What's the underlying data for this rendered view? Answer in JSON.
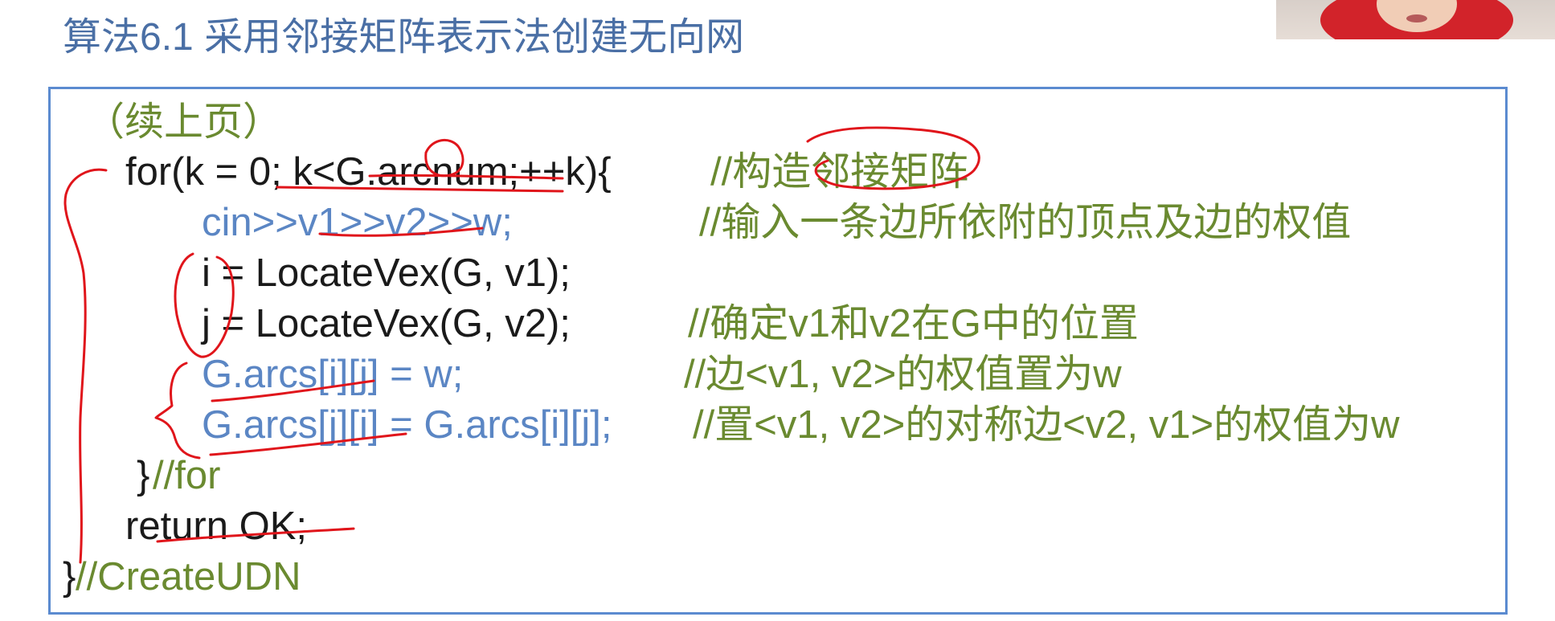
{
  "slide": {
    "title": "算法6.1 采用邻接矩阵表示法创建无向网"
  },
  "code": {
    "continued": "（续上页）",
    "lines": [
      {
        "code": "for(k = 0; k<G.arcnum;++k){",
        "comment": "//构造邻接矩阵"
      },
      {
        "code": "cin>>v1>>v2>>w;",
        "comment": "//输入一条边所依附的顶点及边的权值"
      },
      {
        "code": "i = LocateVex(G, v1);",
        "comment": ""
      },
      {
        "code": "j = LocateVex(G, v2);",
        "comment": "//确定v1和v2在G中的位置"
      },
      {
        "code": "G.arcs[i][j] = w;",
        "comment": "//边<v1, v2>的权值置为w"
      },
      {
        "code": "G.arcs[j][i] = G.arcs[i][j];",
        "comment": "//置<v1, v2>的对称边<v2, v1>的权值为w"
      },
      {
        "code": "}",
        "comment": "//for"
      },
      {
        "code": "return OK;",
        "comment": ""
      },
      {
        "code": "}",
        "comment": "//CreateUDN"
      }
    ]
  },
  "colors": {
    "title": "#4a6fa5",
    "code_black": "#1a1a1a",
    "code_blue": "#5b86c4",
    "comment_green": "#6a8a30",
    "frame_border": "#5b8bd0",
    "annotation_red": "#e0151b"
  },
  "webcam": {
    "icon": "presenter-video-thumbnail"
  }
}
